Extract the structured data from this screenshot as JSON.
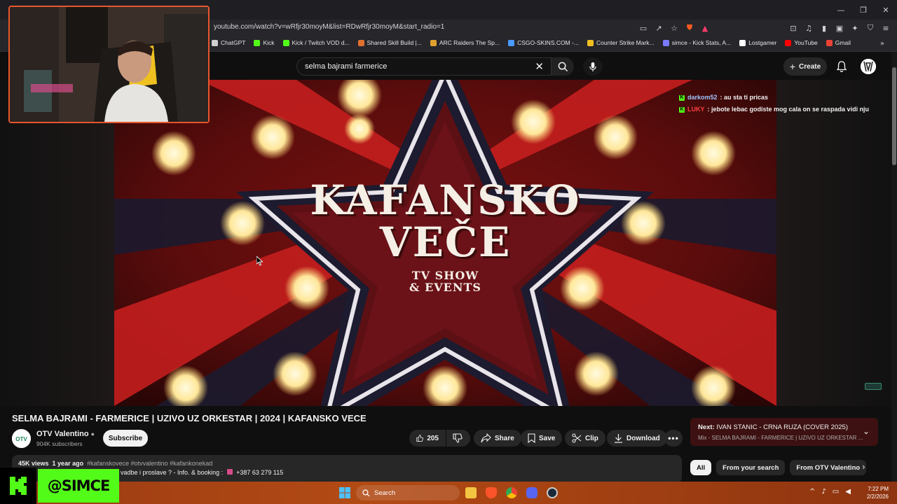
{
  "browser": {
    "url": "youtube.com/watch?v=wRfjr30moyM&list=RDwRfjr30moyM&start_radio=1",
    "bookmarks": [
      {
        "label": "ChatGPT",
        "color": "#cfcfcf"
      },
      {
        "label": "Kick",
        "color": "#53fc18"
      },
      {
        "label": "Kick / Twitch VOD d...",
        "color": "#53fc18"
      },
      {
        "label": "Shared Skill Build |...",
        "color": "#e07030"
      },
      {
        "label": "ARC Raiders The Sp...",
        "color": "#e0a030"
      },
      {
        "label": "CSGO-SKINS.COM -...",
        "color": "#4a9aff"
      },
      {
        "label": "Counter Strike Mark...",
        "color": "#f0c020"
      },
      {
        "label": "simce - Kick Stats, A...",
        "color": "#7a7aff"
      },
      {
        "label": "Lostgamer",
        "color": "#ffffff"
      },
      {
        "label": "YouTube",
        "color": "#ff0000"
      },
      {
        "label": "Gmail",
        "color": "#ea4335"
      }
    ]
  },
  "youtube": {
    "search_query": "selma bajrami farmerice",
    "create_label": "Create"
  },
  "video": {
    "overlay_title_line1": "KAFANSKO",
    "overlay_title_line2": "VEČE",
    "overlay_sub_line1": "TV SHOW",
    "overlay_sub_line2": "& EVENTS",
    "title": "SELMA BAJRAMI - FARMERICE | UZIVO UZ ORKESTAR | 2024 | KAFANSKO VECE",
    "channel_name": "OTV Valentino",
    "subscribers": "904K subscribers",
    "subscribe_label": "Subscribe",
    "likes": "205",
    "share_label": "Share",
    "save_label": "Save",
    "clip_label": "Clip",
    "download_label": "Download",
    "views": "45K views",
    "age": "1 year ago",
    "tags": "#kafanskovece #otvvalentino #kafankonekad",
    "desc_text": "vadbe i proslave ? - Info. & booking :",
    "desc_phone": "+387 63 279 115"
  },
  "chat": [
    {
      "user": "darkom52",
      "message": ": au sta ti pricas",
      "user_color": "#9fc3ff"
    },
    {
      "user": "LUKY",
      "message": ": jebote lebac godiste mog cala on se raspada vidi nju",
      "user_color": "#ff4040"
    }
  ],
  "up_next": {
    "prefix": "Next:",
    "title": "IVAN STANIC - CRNA RUZA (COVER 2025)",
    "subtitle": "Mix - SELMA BAJRAMI - FARMERICE | UZIVO UZ ORKESTAR ..."
  },
  "chips": [
    "All",
    "From your search",
    "From OTV Valentino"
  ],
  "kick": {
    "handle": "@SIMCE",
    "accent": "#53fc18"
  },
  "taskbar": {
    "search_label": "Search",
    "time": "7:22 PM",
    "date": "2/2/2026"
  }
}
